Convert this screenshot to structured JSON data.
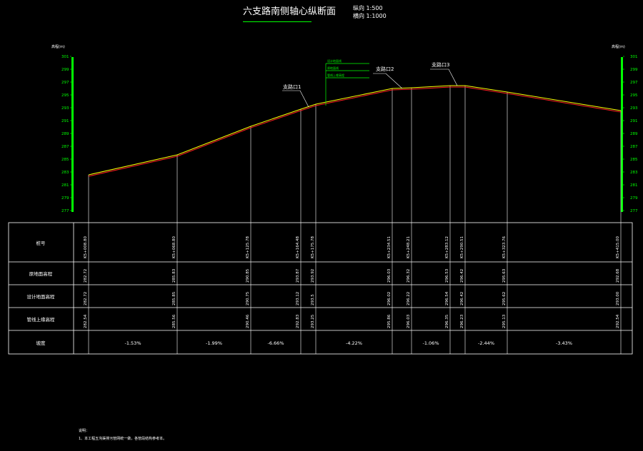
{
  "title": "六支路南侧轴心纵断面",
  "scale": {
    "horizontal": "纵向 1:500",
    "vertical": "横向 1:1000"
  },
  "axis": {
    "left_label": "高程(m)",
    "right_label": "高程(m)",
    "ticks": [
      "301",
      "299",
      "297",
      "295",
      "293",
      "291",
      "289",
      "287",
      "285",
      "283",
      "281",
      "279",
      "277"
    ]
  },
  "callouts": {
    "road1": "支路口1",
    "road2": "支路口2",
    "road3": "支路口3",
    "legend": [
      "设计地面线",
      "原地面线",
      "管线上缘高程"
    ]
  },
  "table": {
    "row_labels": [
      "桩号",
      "原地面高程",
      "设计地面高程",
      "管线上缘高程",
      "坡度"
    ],
    "stations": [
      "K5+008.80",
      "K5+068.80",
      "K5+125.78",
      "K5+164.48",
      "K5+175.78",
      "K5+234.51",
      "K5+248.21",
      "K5+283.12",
      "K5+290.51",
      "K5+323.76",
      "K5+415.00"
    ],
    "ground": [
      "282.72",
      "285.83",
      "290.85",
      "293.87",
      "293.92",
      "296.03",
      "296.32",
      "296.53",
      "296.42",
      "295.63",
      "292.68"
    ],
    "design": [
      "282.72",
      "285.85",
      "290.75",
      "293.12",
      "293.5",
      "296.02",
      "296.22",
      "296.54",
      "296.42",
      "295.62",
      "293.00"
    ],
    "pipe": [
      "282.54",
      "285.56",
      "290.46",
      "292.83",
      "293.25",
      "295.86",
      "296.03",
      "296.35",
      "296.23",
      "295.13",
      "292.54"
    ],
    "slopes": [
      "-1.53%",
      "-1.99%",
      "-6.66%",
      "-4.22%",
      "-1.06%",
      "-2.44%",
      "-3.43%"
    ]
  },
  "notes": {
    "heading": "说明：",
    "line1": "1、本工程五沟渠排污管网统一做，各管段结构参考本。"
  }
}
